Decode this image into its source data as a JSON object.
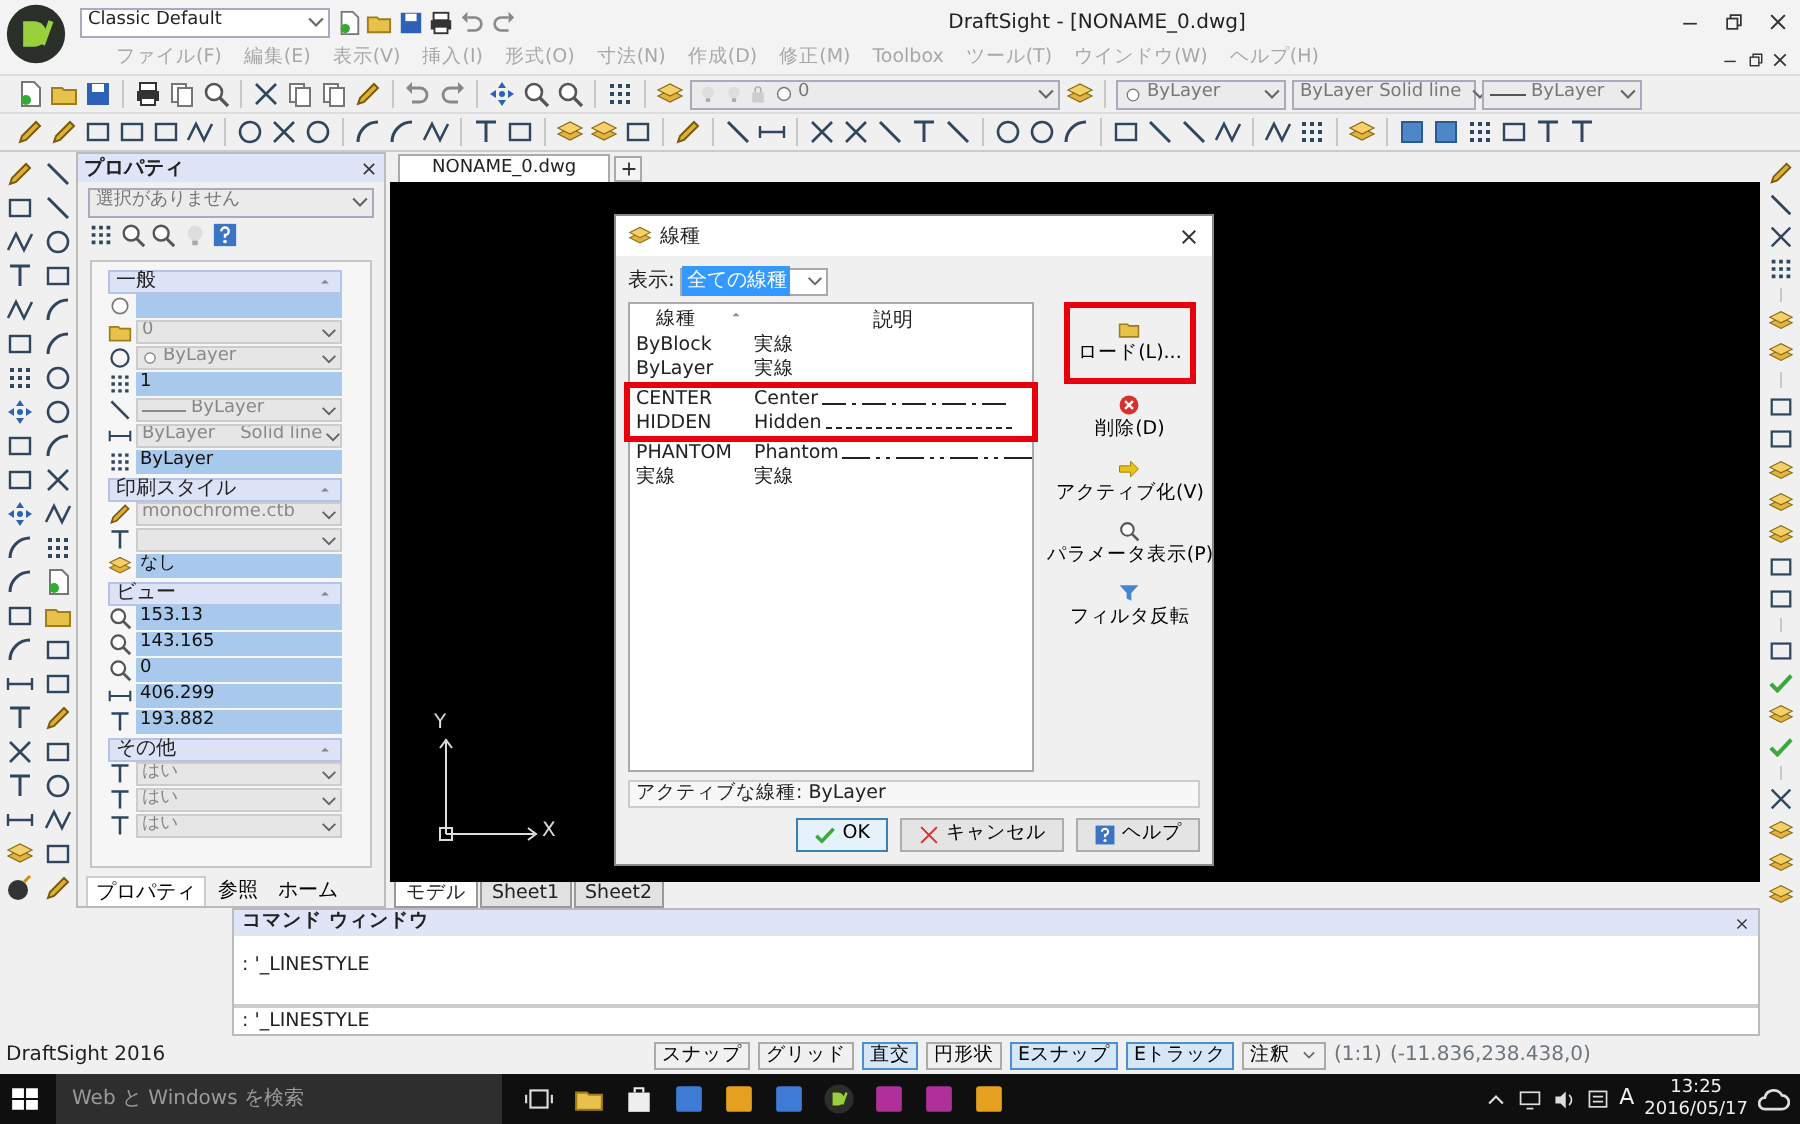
{
  "title_bar": {
    "workspace": "Classic Default",
    "title": "DraftSight - [NONAME_0.dwg]"
  },
  "menu": [
    {
      "label": "ファイル(F)",
      "disabled": true
    },
    {
      "label": "編集(E)",
      "disabled": true
    },
    {
      "label": "表示(V)",
      "disabled": true
    },
    {
      "label": "挿入(I)",
      "disabled": true
    },
    {
      "label": "形式(O)",
      "disabled": true
    },
    {
      "label": "寸法(N)",
      "disabled": true
    },
    {
      "label": "作成(D)",
      "disabled": true
    },
    {
      "label": "修正(M)",
      "disabled": true
    },
    {
      "label": "Toolbox",
      "disabled": true
    },
    {
      "label": "ツール(T)",
      "disabled": true
    },
    {
      "label": "ウインドウ(W)",
      "disabled": true
    },
    {
      "label": "ヘルプ(H)",
      "disabled": true
    }
  ],
  "toolbar": {
    "layer": "0",
    "color_setting": "ByLayer",
    "linetype": "ByLayer",
    "linetype_description": "Solid line",
    "lineweight": "ByLayer"
  },
  "properties": {
    "title": "プロパティ",
    "selection": "選択がありません",
    "sections": [
      {
        "title": "一般",
        "rows": [
          {
            "kind": "field"
          },
          {
            "kind": "combo",
            "value": "0"
          },
          {
            "kind": "color-combo",
            "value": "ByLayer"
          },
          {
            "kind": "field",
            "value": "1"
          },
          {
            "kind": "lineweight-combo",
            "value": "ByLayer"
          },
          {
            "kind": "combo",
            "value": "ByLayer",
            "detail": "Solid line"
          },
          {
            "kind": "field",
            "value": "ByLayer"
          }
        ]
      },
      {
        "title": "印刷スタイル",
        "rows": [
          {
            "kind": "combo",
            "value": "monochrome.ctb"
          },
          {
            "kind": "combo"
          },
          {
            "kind": "field",
            "value": "なし"
          }
        ]
      },
      {
        "title": "ビュー",
        "rows": [
          {
            "kind": "field",
            "value": "153.13"
          },
          {
            "kind": "field",
            "value": "143.165"
          },
          {
            "kind": "field",
            "value": "0"
          },
          {
            "kind": "field",
            "value": "406.299"
          },
          {
            "kind": "field",
            "value": "193.882"
          }
        ]
      },
      {
        "title": "その他",
        "rows": [
          {
            "kind": "combo",
            "value": "はい"
          },
          {
            "kind": "combo",
            "value": "はい"
          },
          {
            "kind": "combo",
            "value": "はい"
          }
        ]
      }
    ],
    "tabs": [
      {
        "label": "プロパティ",
        "selected": true
      },
      {
        "label": "参照",
        "selected": false
      },
      {
        "label": "ホーム",
        "selected": false
      }
    ]
  },
  "document_tabs": [
    {
      "label": "NONAME_0.dwg",
      "selected": true
    }
  ],
  "canvas": {
    "axis_y": "Y",
    "axis_x": "X"
  },
  "sheet_tabs": [
    {
      "label": "モデル",
      "selected": true
    },
    {
      "label": "Sheet1",
      "selected": false
    },
    {
      "label": "Sheet2",
      "selected": false
    }
  ],
  "dialog": {
    "title": "線種",
    "filter_label": "表示:",
    "filter_value": "全ての線種",
    "columns": [
      "線種",
      "説明"
    ],
    "rows": [
      {
        "name": "ByBlock",
        "description": "実線",
        "kind": "solid",
        "highlighted": false
      },
      {
        "name": "ByLayer",
        "description": "実線",
        "kind": "solid",
        "highlighted": false
      },
      {
        "name": "CENTER",
        "description": "Center",
        "kind": "center",
        "highlighted": true
      },
      {
        "name": "HIDDEN",
        "description": "Hidden",
        "kind": "hidden",
        "highlighted": true
      },
      {
        "name": "PHANTOM",
        "description": "Phantom",
        "kind": "phantom",
        "highlighted": false
      },
      {
        "name": "実線",
        "description": "実線",
        "kind": "solid",
        "highlighted": false
      }
    ],
    "actions": [
      {
        "label": "ロード(L)...",
        "kind": "load",
        "highlighted": true
      },
      {
        "label": "削除(D)",
        "kind": "delete",
        "highlighted": false
      },
      {
        "label": "アクティブ化(V)",
        "kind": "activate",
        "highlighted": false
      },
      {
        "label": "パラメータ表示(P)",
        "kind": "parameters",
        "highlighted": false
      },
      {
        "label": "フィルタ反転",
        "kind": "filter",
        "highlighted": false
      }
    ],
    "active_linetype": "アクティブな線種: ByLayer",
    "buttons": [
      {
        "label": "OK",
        "kind": "ok"
      },
      {
        "label": "キャンセル",
        "kind": "cancel"
      },
      {
        "label": "ヘルプ",
        "kind": "help"
      }
    ]
  },
  "command_window": {
    "title": "コマンド ウィンドウ",
    "history": [
      ": '_LINESTYLE"
    ],
    "input": ": '_LINESTYLE"
  },
  "status_bar": {
    "app": "DraftSight 2016",
    "toggles": [
      {
        "label": "スナップ",
        "on": false
      },
      {
        "label": "グリッド",
        "on": false
      },
      {
        "label": "直交",
        "on": true
      },
      {
        "label": "円形状",
        "on": false
      },
      {
        "label": "Eスナップ",
        "on": true
      },
      {
        "label": "Eトラック",
        "on": true
      }
    ],
    "annotation": "注釈",
    "scale": "(1:1)",
    "coordinates": "(-11.836,238.438,0)"
  },
  "taskbar": {
    "search_placeholder": "Web と Windows を検索",
    "ime": "A",
    "time": "13:25",
    "date": "2016/05/17"
  }
}
